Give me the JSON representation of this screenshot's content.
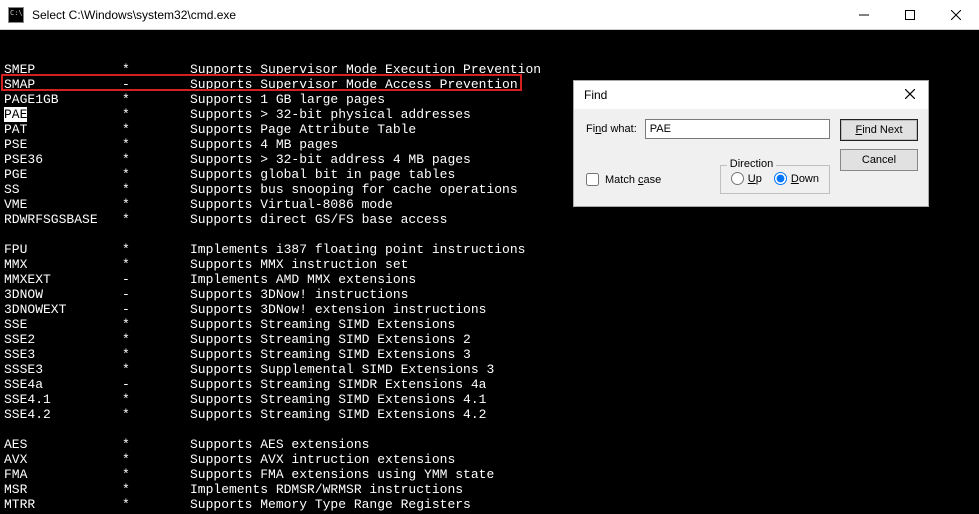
{
  "window": {
    "title": "Select C:\\Windows\\system32\\cmd.exe"
  },
  "highlighted_row_index": 2,
  "rows": [
    {
      "name": "SMEP",
      "flag": "*",
      "desc": "Supports Supervisor Mode Execution Prevention"
    },
    {
      "name": "SMAP",
      "flag": "-",
      "desc": "Supports Supervisor Mode Access Prevention"
    },
    {
      "name": "PAGE1GB",
      "flag": "*",
      "desc": "Supports 1 GB large pages"
    },
    {
      "name": "PAE",
      "flag": "*",
      "desc": "Supports > 32-bit physical addresses"
    },
    {
      "name": "PAT",
      "flag": "*",
      "desc": "Supports Page Attribute Table"
    },
    {
      "name": "PSE",
      "flag": "*",
      "desc": "Supports 4 MB pages"
    },
    {
      "name": "PSE36",
      "flag": "*",
      "desc": "Supports > 32-bit address 4 MB pages"
    },
    {
      "name": "PGE",
      "flag": "*",
      "desc": "Supports global bit in page tables"
    },
    {
      "name": "SS",
      "flag": "*",
      "desc": "Supports bus snooping for cache operations"
    },
    {
      "name": "VME",
      "flag": "*",
      "desc": "Supports Virtual-8086 mode"
    },
    {
      "name": "RDWRFSGSBASE",
      "flag": "*",
      "desc": "Supports direct GS/FS base access"
    },
    {
      "blank": true
    },
    {
      "name": "FPU",
      "flag": "*",
      "desc": "Implements i387 floating point instructions"
    },
    {
      "name": "MMX",
      "flag": "*",
      "desc": "Supports MMX instruction set"
    },
    {
      "name": "MMXEXT",
      "flag": "-",
      "desc": "Implements AMD MMX extensions"
    },
    {
      "name": "3DNOW",
      "flag": "-",
      "desc": "Supports 3DNow! instructions"
    },
    {
      "name": "3DNOWEXT",
      "flag": "-",
      "desc": "Supports 3DNow! extension instructions"
    },
    {
      "name": "SSE",
      "flag": "*",
      "desc": "Supports Streaming SIMD Extensions"
    },
    {
      "name": "SSE2",
      "flag": "*",
      "desc": "Supports Streaming SIMD Extensions 2"
    },
    {
      "name": "SSE3",
      "flag": "*",
      "desc": "Supports Streaming SIMD Extensions 3"
    },
    {
      "name": "SSSE3",
      "flag": "*",
      "desc": "Supports Supplemental SIMD Extensions 3"
    },
    {
      "name": "SSE4a",
      "flag": "-",
      "desc": "Supports Streaming SIMDR Extensions 4a"
    },
    {
      "name": "SSE4.1",
      "flag": "*",
      "desc": "Supports Streaming SIMD Extensions 4.1"
    },
    {
      "name": "SSE4.2",
      "flag": "*",
      "desc": "Supports Streaming SIMD Extensions 4.2"
    },
    {
      "blank": true
    },
    {
      "name": "AES",
      "flag": "*",
      "desc": "Supports AES extensions"
    },
    {
      "name": "AVX",
      "flag": "*",
      "desc": "Supports AVX intruction extensions"
    },
    {
      "name": "FMA",
      "flag": "*",
      "desc": "Supports FMA extensions using YMM state"
    },
    {
      "name": "MSR",
      "flag": "*",
      "desc": "Implements RDMSR/WRMSR instructions"
    },
    {
      "name": "MTRR",
      "flag": "*",
      "desc": "Supports Memory Type Range Registers"
    }
  ],
  "find": {
    "title": "Find",
    "label_prefix": "Fi",
    "label_underline": "n",
    "label_suffix": "d what:",
    "value": "PAE",
    "find_next_prefix": "",
    "find_next_underline": "F",
    "find_next_suffix": "ind Next",
    "cancel": "Cancel",
    "match_case_prefix": "Match ",
    "match_case_underline": "c",
    "match_case_suffix": "ase",
    "match_case_checked": false,
    "direction_label": "Direction",
    "up_underline": "U",
    "up_suffix": "p",
    "down_underline": "D",
    "down_suffix": "own",
    "direction_selected": "down"
  }
}
